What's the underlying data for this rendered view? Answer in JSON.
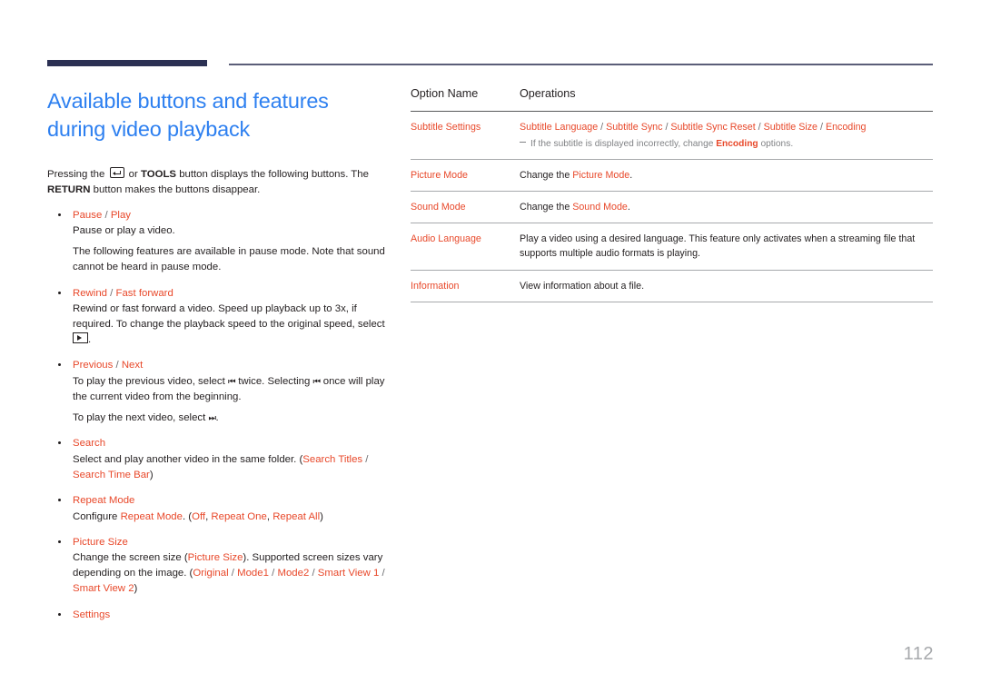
{
  "colors": {
    "accent": "#e8482a",
    "heading_blue": "#2e80f0",
    "rule_navy": "#2b3053",
    "rule_thin": "#5b5e78",
    "note_gray": "#808285",
    "page_number_gray": "#a7a9ac"
  },
  "header": {
    "rule_thick_name": "header-thick-rule",
    "rule_thin_name": "header-thin-rule"
  },
  "page": {
    "title": "Available buttons and features during video playback",
    "number": "112"
  },
  "intro": {
    "part1": "Pressing the",
    "key_icon": "enter-key-icon",
    "part2": "or",
    "tools": "TOOLS",
    "part3": "button displays the following buttons. The",
    "return": "RETURN",
    "part4": "button makes the buttons disappear."
  },
  "bullets": [
    {
      "title_main": "Pause",
      "title_sep": " / ",
      "title_alt": "Play",
      "lines": [
        "Pause or play a video.",
        "The following features are available in pause mode. Note that sound cannot be heard in pause mode."
      ]
    },
    {
      "title_main": "Rewind",
      "title_sep": " / ",
      "title_alt": "Fast forward",
      "lines": [
        "Rewind or fast forward a video. Speed up playback up to 3x, if required. To change the playback speed to the original speed, select"
      ],
      "trailing_icon": "play-box-icon",
      "trailing_text": "."
    },
    {
      "title_main": "Previous",
      "title_sep": " / ",
      "title_alt": "Next",
      "lines_rich": [
        {
          "pre": "To play the previous video, select",
          "icon": "skip-back-icon",
          "mid": "twice. Selecting",
          "icon2": "skip-back-icon",
          "post": "once will play the current video from the beginning."
        },
        {
          "pre": "To play the next video, select",
          "icon": "skip-forward-icon",
          "post": "."
        }
      ]
    },
    {
      "title_main": "Search",
      "lines": [
        "Select and play another video in the same folder. (Search Titles / Search Time Bar)"
      ],
      "inline_accents": [
        "Search Titles",
        "Search Time Bar"
      ]
    },
    {
      "title_main": "Repeat Mode",
      "lines": [
        "Configure Repeat Mode. (Off, Repeat One, Repeat All)"
      ],
      "inline_accents": [
        "Repeat Mode",
        "Off",
        "Repeat One",
        "Repeat All"
      ]
    },
    {
      "title_main": "Picture Size",
      "lines": [
        "Change the screen size (Picture Size). Supported screen sizes vary depending on the image. (Original / Mode1 / Mode2 / Smart View 1 / Smart View 2)"
      ],
      "inline_accents": [
        "Picture Size",
        "Original",
        "Mode1",
        "Mode2",
        "Smart View 1",
        "Smart View 2"
      ]
    },
    {
      "title_main": "Settings",
      "lines": []
    }
  ],
  "bullet_text": {
    "b0_title_main": "Pause",
    "b0_title_alt": "Play",
    "b0_line1": "Pause or play a video.",
    "b0_line2": "The following features are available in pause mode. Note that sound cannot be heard in pause mode.",
    "b1_title_main": "Rewind",
    "b1_title_alt": "Fast forward",
    "b1_line1": "Rewind or fast forward a video. Speed up playback up to 3x, if required. To change the playback speed to the original speed, select",
    "b1_period": ".",
    "b2_title_main": "Previous",
    "b2_title_alt": "Next",
    "b2_l1_pre": "To play the previous video, select",
    "b2_l1_mid": "twice. Selecting",
    "b2_l1_post": "once will play the current video from the beginning.",
    "b2_l2_pre": "To play the next video, select",
    "b2_l2_post": ".",
    "b3_title_main": "Search",
    "b3_pre": "Select and play another video in the same folder. (",
    "b3_a1": "Search Titles",
    "b3_mid": " / ",
    "b3_a2": "Search Time Bar",
    "b3_post": ")",
    "b4_title_main": "Repeat Mode",
    "b4_pre": "Configure ",
    "b4_a1": "Repeat Mode",
    "b4_mid1": ". (",
    "b4_a2": "Off",
    "b4_mid2": ", ",
    "b4_a3": "Repeat One",
    "b4_mid3": ", ",
    "b4_a4": "Repeat All",
    "b4_post": ")",
    "b5_title_main": "Picture Size",
    "b5_pre": "Change the screen size (",
    "b5_a1": "Picture Size",
    "b5_mid1": "). Supported screen sizes vary depending on the image. (",
    "b5_a2": "Original",
    "b5_s1": " / ",
    "b5_a3": "Mode1",
    "b5_s2": " / ",
    "b5_a4": "Mode2",
    "b5_s3": " / ",
    "b5_a5": "Smart View 1",
    "b5_s4": " / ",
    "b5_a6": "Smart View 2",
    "b5_post": ")",
    "b6_title_main": "Settings"
  },
  "table": {
    "headers": [
      "Option Name",
      "Operations"
    ],
    "rows": [
      {
        "name": "Subtitle Settings",
        "ops_accent_chain": [
          "Subtitle Language",
          "Subtitle Sync",
          "Subtitle Sync Reset",
          "Subtitle Size",
          "Encoding"
        ],
        "separator": " / ",
        "note_pre": "If the subtitle is displayed incorrectly, change ",
        "note_bold": "Encoding",
        "note_post": " options."
      },
      {
        "name": "Picture Mode",
        "ops_pre": "Change the ",
        "ops_accent": "Picture Mode",
        "ops_post": "."
      },
      {
        "name": "Sound Mode",
        "ops_pre": "Change the ",
        "ops_accent": "Sound Mode",
        "ops_post": "."
      },
      {
        "name": "Audio Language",
        "ops_plain": "Play a video using a desired language. This feature only activates when a streaming file that supports multiple audio formats is playing."
      },
      {
        "name": "Information",
        "ops_plain": "View information about a file."
      }
    ]
  }
}
